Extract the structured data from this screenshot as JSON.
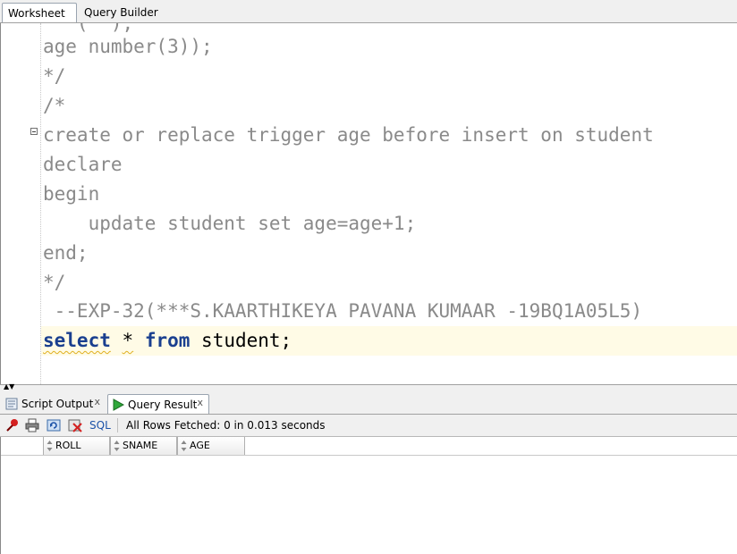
{
  "top_tabs": {
    "worksheet": "Worksheet",
    "query_builder": "Query Builder"
  },
  "editor": {
    "lines": [
      "age number(3));",
      "*/",
      "/*",
      "create or replace trigger age before insert on student",
      "declare",
      "begin",
      "    update student set age=age+1;",
      "end;",
      "*/",
      " --EXP-32(***S.KAARTHIKEYA PAVANA KUMAAR -19BQ1A05L5)"
    ],
    "current_line": {
      "kw1": "select",
      "star": "*",
      "kw2": "from",
      "rest": " student;"
    }
  },
  "bottom_tabs": {
    "script_output": "Script Output",
    "query_result": "Query Result",
    "close": "x"
  },
  "toolbar": {
    "sql_label": "SQL",
    "status": "All Rows Fetched: 0 in 0.013 seconds"
  },
  "grid": {
    "columns": [
      "ROLL",
      "SNAME",
      "AGE"
    ]
  },
  "colors": {
    "keyword": "#1a3f8f",
    "comment": "#8a8a8a",
    "current_line_bg": "#fffbe6"
  }
}
